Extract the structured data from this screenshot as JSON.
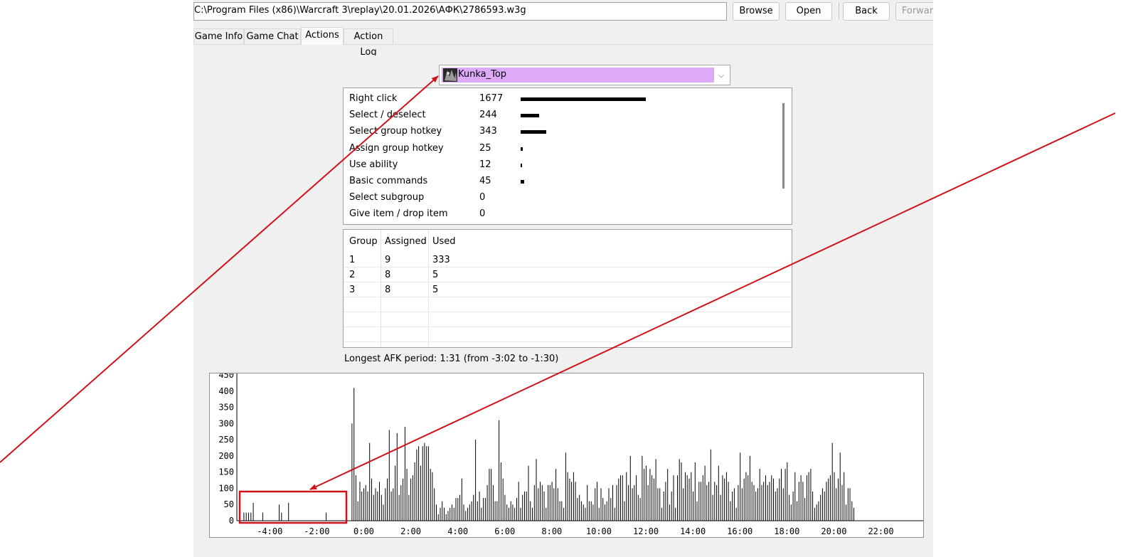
{
  "toolbar": {
    "path_value": "C:\\Program Files (x86)\\Warcraft 3\\replay\\20.01.2026\\АФК\\2786593.w3g",
    "browse_label": "Browse",
    "open_label": "Open",
    "back_label": "Back",
    "forward_label": "Forward"
  },
  "tabs": [
    {
      "label": "Game Info",
      "active": false
    },
    {
      "label": "Game Chat",
      "active": false
    },
    {
      "label": "Actions",
      "active": true
    },
    {
      "label": "Action Log",
      "active": false
    }
  ],
  "player_select": {
    "selected": "Kunka_Top",
    "color": "#dcaaf8"
  },
  "actions": [
    {
      "label": "Right click",
      "count": "1677",
      "value": 1677
    },
    {
      "label": "Select / deselect",
      "count": "244",
      "value": 244
    },
    {
      "label": "Select group hotkey",
      "count": "343",
      "value": 343
    },
    {
      "label": "Assign group hotkey",
      "count": "25",
      "value": 25
    },
    {
      "label": "Use ability",
      "count": "12",
      "value": 12
    },
    {
      "label": "Basic commands",
      "count": "45",
      "value": 45
    },
    {
      "label": "Select subgroup",
      "count": "0",
      "value": 0
    },
    {
      "label": "Give item / drop item",
      "count": "0",
      "value": 0
    }
  ],
  "groups": {
    "headers": [
      "Group",
      "Assigned",
      "Used"
    ],
    "rows": [
      [
        "1",
        "9",
        "333"
      ],
      [
        "2",
        "8",
        "5"
      ],
      [
        "3",
        "8",
        "5"
      ]
    ]
  },
  "afk_text": "Longest AFK period: 1:31 (from -3:02 to -1:30)",
  "chart_data": {
    "type": "bar",
    "ylim": [
      0,
      450
    ],
    "y_ticks": [
      "0",
      "50",
      "100",
      "150",
      "200",
      "250",
      "300",
      "350",
      "400",
      "450"
    ],
    "xlim_minutes": [
      -5.4,
      23.8
    ],
    "x_ticks": [
      {
        "label": "-4:00",
        "minute": -4
      },
      {
        "label": "-2:00",
        "minute": -2
      },
      {
        "label": "0:00",
        "minute": 0
      },
      {
        "label": "2:00",
        "minute": 2
      },
      {
        "label": "4:00",
        "minute": 4
      },
      {
        "label": "6:00",
        "minute": 6
      },
      {
        "label": "8:00",
        "minute": 8
      },
      {
        "label": "10:00",
        "minute": 10
      },
      {
        "label": "12:00",
        "minute": 12
      },
      {
        "label": "14:00",
        "minute": 14
      },
      {
        "label": "16:00",
        "minute": 16
      },
      {
        "label": "18:00",
        "minute": 18
      },
      {
        "label": "20:00",
        "minute": 20
      },
      {
        "label": "22:00",
        "minute": 22
      }
    ],
    "bar_color": "#000000",
    "pre_game": {
      "minutes": [
        -5.1,
        -5.0,
        -4.9,
        -4.8,
        -4.7,
        -4.3,
        -3.6,
        -3.5,
        -3.2,
        -1.6
      ],
      "values": [
        25,
        25,
        25,
        25,
        55,
        25,
        50,
        25,
        55,
        25
      ]
    },
    "game": {
      "start_minute": -0.5,
      "step_minute": 0.0834,
      "values": [
        300,
        410,
        140,
        60,
        120,
        90,
        100,
        110,
        90,
        240,
        130,
        80,
        100,
        90,
        120,
        80,
        50,
        100,
        130,
        280,
        90,
        100,
        170,
        270,
        80,
        110,
        130,
        290,
        160,
        80,
        130,
        140,
        180,
        220,
        230,
        170,
        230,
        240,
        230,
        230,
        160,
        150,
        100,
        50,
        20,
        40,
        60,
        40,
        20,
        30,
        40,
        50,
        40,
        70,
        70,
        80,
        130,
        50,
        30,
        40,
        50,
        60,
        80,
        250,
        60,
        90,
        40,
        70,
        70,
        110,
        160,
        160,
        110,
        60,
        60,
        310,
        180,
        130,
        80,
        50,
        40,
        60,
        50,
        40,
        70,
        120,
        40,
        80,
        90,
        90,
        170,
        60,
        40,
        110,
        190,
        100,
        120,
        110,
        90,
        40,
        110,
        110,
        120,
        100,
        160,
        100,
        60,
        60,
        40,
        210,
        150,
        130,
        120,
        150,
        120,
        70,
        80,
        60,
        50,
        40,
        110,
        60,
        60,
        50,
        100,
        120,
        40,
        100,
        70,
        50,
        60,
        100,
        70,
        110,
        40,
        110,
        130,
        140,
        140,
        60,
        150,
        110,
        200,
        100,
        110,
        140,
        80,
        70,
        200,
        160,
        170,
        110,
        160,
        140,
        130,
        190,
        100,
        100,
        40,
        90,
        120,
        160,
        50,
        90,
        140,
        40,
        140,
        190,
        180,
        100,
        150,
        140,
        130,
        150,
        90,
        180,
        60,
        120,
        120,
        140,
        170,
        110,
        120,
        220,
        80,
        120,
        110,
        170,
        80,
        140,
        130,
        150,
        120,
        60,
        90,
        100,
        40,
        110,
        210,
        100,
        130,
        150,
        140,
        200,
        120,
        110,
        90,
        100,
        160,
        110,
        120,
        140,
        110,
        120,
        140,
        130,
        90,
        100,
        130,
        160,
        100,
        160,
        180,
        80,
        50,
        90,
        150,
        60,
        120,
        140,
        120,
        70,
        140,
        150,
        160,
        90,
        40,
        50,
        60,
        80,
        100,
        90,
        120,
        130,
        140,
        240,
        150,
        100,
        130,
        210,
        110,
        150,
        50,
        100,
        100,
        60,
        40
      ]
    }
  }
}
